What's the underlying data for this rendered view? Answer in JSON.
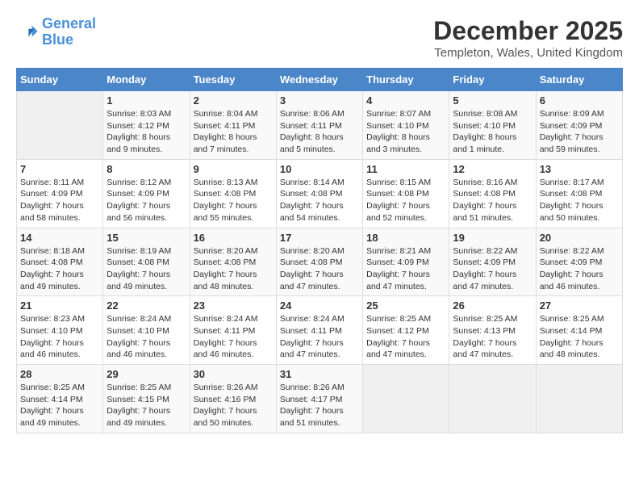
{
  "header": {
    "logo_line1": "General",
    "logo_line2": "Blue",
    "month_year": "December 2025",
    "location": "Templeton, Wales, United Kingdom"
  },
  "days_of_week": [
    "Sunday",
    "Monday",
    "Tuesday",
    "Wednesday",
    "Thursday",
    "Friday",
    "Saturday"
  ],
  "weeks": [
    [
      {
        "day": "",
        "content": ""
      },
      {
        "day": "1",
        "content": "Sunrise: 8:03 AM\nSunset: 4:12 PM\nDaylight: 8 hours\nand 9 minutes."
      },
      {
        "day": "2",
        "content": "Sunrise: 8:04 AM\nSunset: 4:11 PM\nDaylight: 8 hours\nand 7 minutes."
      },
      {
        "day": "3",
        "content": "Sunrise: 8:06 AM\nSunset: 4:11 PM\nDaylight: 8 hours\nand 5 minutes."
      },
      {
        "day": "4",
        "content": "Sunrise: 8:07 AM\nSunset: 4:10 PM\nDaylight: 8 hours\nand 3 minutes."
      },
      {
        "day": "5",
        "content": "Sunrise: 8:08 AM\nSunset: 4:10 PM\nDaylight: 8 hours\nand 1 minute."
      },
      {
        "day": "6",
        "content": "Sunrise: 8:09 AM\nSunset: 4:09 PM\nDaylight: 7 hours\nand 59 minutes."
      }
    ],
    [
      {
        "day": "7",
        "content": "Sunrise: 8:11 AM\nSunset: 4:09 PM\nDaylight: 7 hours\nand 58 minutes."
      },
      {
        "day": "8",
        "content": "Sunrise: 8:12 AM\nSunset: 4:09 PM\nDaylight: 7 hours\nand 56 minutes."
      },
      {
        "day": "9",
        "content": "Sunrise: 8:13 AM\nSunset: 4:08 PM\nDaylight: 7 hours\nand 55 minutes."
      },
      {
        "day": "10",
        "content": "Sunrise: 8:14 AM\nSunset: 4:08 PM\nDaylight: 7 hours\nand 54 minutes."
      },
      {
        "day": "11",
        "content": "Sunrise: 8:15 AM\nSunset: 4:08 PM\nDaylight: 7 hours\nand 52 minutes."
      },
      {
        "day": "12",
        "content": "Sunrise: 8:16 AM\nSunset: 4:08 PM\nDaylight: 7 hours\nand 51 minutes."
      },
      {
        "day": "13",
        "content": "Sunrise: 8:17 AM\nSunset: 4:08 PM\nDaylight: 7 hours\nand 50 minutes."
      }
    ],
    [
      {
        "day": "14",
        "content": "Sunrise: 8:18 AM\nSunset: 4:08 PM\nDaylight: 7 hours\nand 49 minutes."
      },
      {
        "day": "15",
        "content": "Sunrise: 8:19 AM\nSunset: 4:08 PM\nDaylight: 7 hours\nand 49 minutes."
      },
      {
        "day": "16",
        "content": "Sunrise: 8:20 AM\nSunset: 4:08 PM\nDaylight: 7 hours\nand 48 minutes."
      },
      {
        "day": "17",
        "content": "Sunrise: 8:20 AM\nSunset: 4:08 PM\nDaylight: 7 hours\nand 47 minutes."
      },
      {
        "day": "18",
        "content": "Sunrise: 8:21 AM\nSunset: 4:09 PM\nDaylight: 7 hours\nand 47 minutes."
      },
      {
        "day": "19",
        "content": "Sunrise: 8:22 AM\nSunset: 4:09 PM\nDaylight: 7 hours\nand 47 minutes."
      },
      {
        "day": "20",
        "content": "Sunrise: 8:22 AM\nSunset: 4:09 PM\nDaylight: 7 hours\nand 46 minutes."
      }
    ],
    [
      {
        "day": "21",
        "content": "Sunrise: 8:23 AM\nSunset: 4:10 PM\nDaylight: 7 hours\nand 46 minutes."
      },
      {
        "day": "22",
        "content": "Sunrise: 8:24 AM\nSunset: 4:10 PM\nDaylight: 7 hours\nand 46 minutes."
      },
      {
        "day": "23",
        "content": "Sunrise: 8:24 AM\nSunset: 4:11 PM\nDaylight: 7 hours\nand 46 minutes."
      },
      {
        "day": "24",
        "content": "Sunrise: 8:24 AM\nSunset: 4:11 PM\nDaylight: 7 hours\nand 47 minutes."
      },
      {
        "day": "25",
        "content": "Sunrise: 8:25 AM\nSunset: 4:12 PM\nDaylight: 7 hours\nand 47 minutes."
      },
      {
        "day": "26",
        "content": "Sunrise: 8:25 AM\nSunset: 4:13 PM\nDaylight: 7 hours\nand 47 minutes."
      },
      {
        "day": "27",
        "content": "Sunrise: 8:25 AM\nSunset: 4:14 PM\nDaylight: 7 hours\nand 48 minutes."
      }
    ],
    [
      {
        "day": "28",
        "content": "Sunrise: 8:25 AM\nSunset: 4:14 PM\nDaylight: 7 hours\nand 49 minutes."
      },
      {
        "day": "29",
        "content": "Sunrise: 8:25 AM\nSunset: 4:15 PM\nDaylight: 7 hours\nand 49 minutes."
      },
      {
        "day": "30",
        "content": "Sunrise: 8:26 AM\nSunset: 4:16 PM\nDaylight: 7 hours\nand 50 minutes."
      },
      {
        "day": "31",
        "content": "Sunrise: 8:26 AM\nSunset: 4:17 PM\nDaylight: 7 hours\nand 51 minutes."
      },
      {
        "day": "",
        "content": ""
      },
      {
        "day": "",
        "content": ""
      },
      {
        "day": "",
        "content": ""
      }
    ]
  ]
}
